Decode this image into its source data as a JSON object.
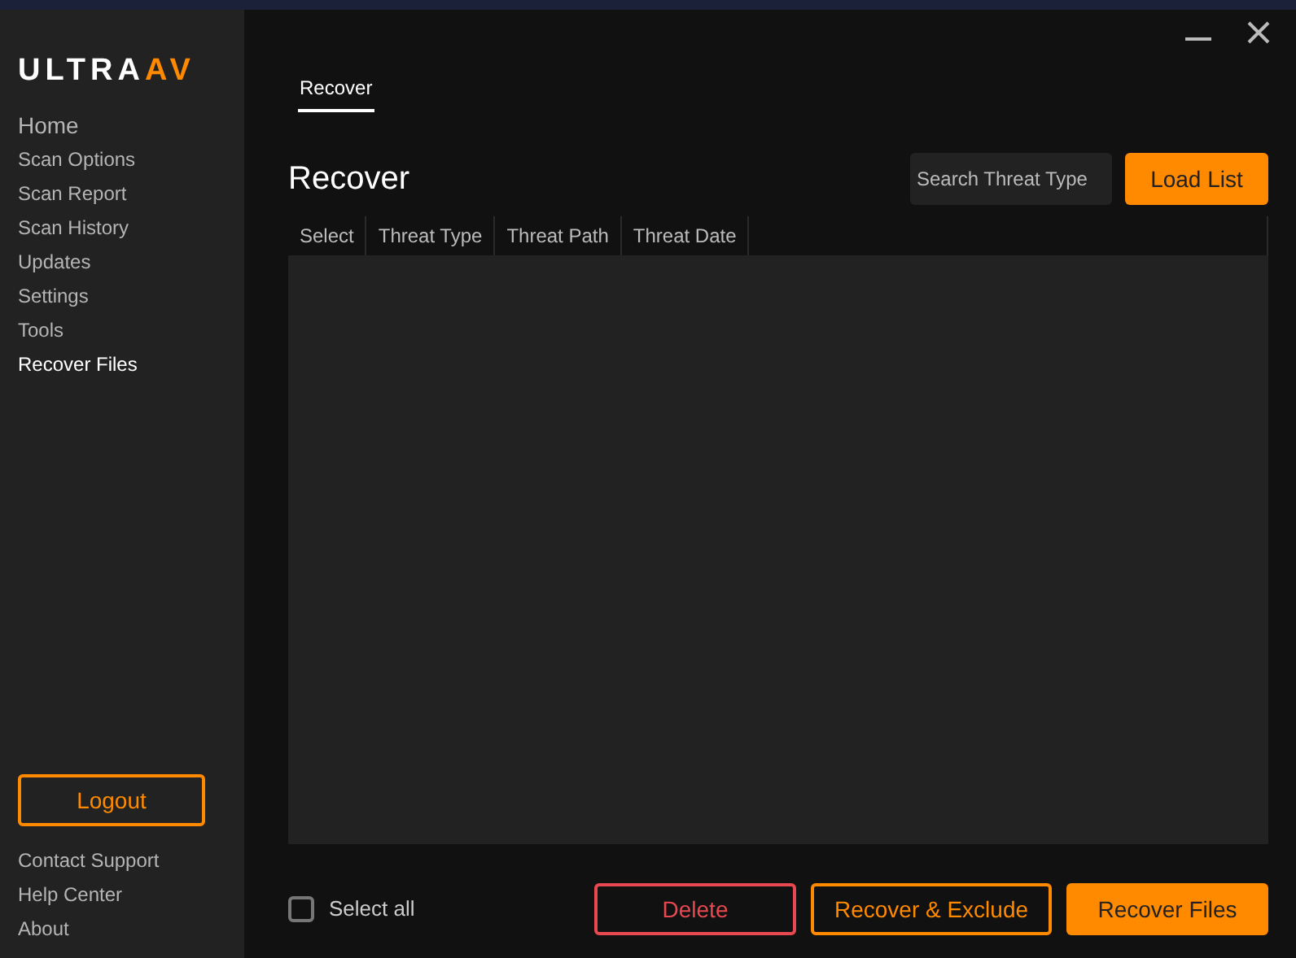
{
  "logo": {
    "main": "ULTRA",
    "accent": "AV"
  },
  "sidebar": {
    "items": [
      {
        "label": "Home",
        "selected": false
      },
      {
        "label": "Scan Options",
        "selected": false
      },
      {
        "label": "Scan Report",
        "selected": false
      },
      {
        "label": "Scan History",
        "selected": false
      },
      {
        "label": "Updates",
        "selected": false
      },
      {
        "label": "Settings",
        "selected": false
      },
      {
        "label": "Tools",
        "selected": false
      },
      {
        "label": "Recover Files",
        "selected": true
      }
    ],
    "logout": "Logout",
    "footer_links": [
      "Contact Support",
      "Help Center",
      "About"
    ]
  },
  "tabs": [
    {
      "label": "Recover",
      "selected": true
    }
  ],
  "heading": "Recover",
  "search": {
    "placeholder": "Search Threat Type"
  },
  "load_button": "Load List",
  "table": {
    "columns": [
      "Select",
      "Threat Type",
      "Threat Path",
      "Threat Date"
    ]
  },
  "select_all": {
    "label": "Select all",
    "checked": false
  },
  "buttons": [
    {
      "label": "Delete",
      "kind": "danger"
    },
    {
      "label": "Recover & Exclude",
      "kind": "outline"
    },
    {
      "label": "Recover Files",
      "kind": "primary"
    }
  ]
}
